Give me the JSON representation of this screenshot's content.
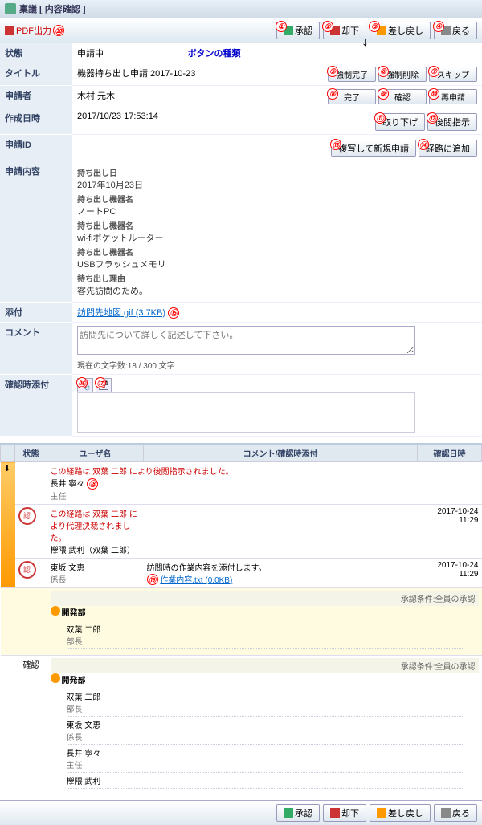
{
  "header": {
    "title": "稟議  [ 内容確認 ]"
  },
  "toolbar": {
    "pdf": "PDF出力",
    "buttons": {
      "approve": "承認",
      "reject": "却下",
      "sendback": "差し戻し",
      "back": "戻る"
    }
  },
  "button_types_label": "ボタンの種類",
  "action_grid": {
    "force_complete": "強制完了",
    "force_delete": "強制削除",
    "skip": "スキップ",
    "complete": "完了",
    "confirm": "確認",
    "reapply": "再申請",
    "withdraw": "取り下げ",
    "defer": "後閲指示",
    "copy_new": "複写して新規申請",
    "add_route": "経路に追加"
  },
  "details": {
    "status_label": "状態",
    "status_value": "申請中",
    "title_label": "タイトル",
    "title_value": "機器持ち出し申請 2017-10-23",
    "applicant_label": "申請者",
    "applicant_value": "木村 元木",
    "created_label": "作成日時",
    "created_value": "2017/10/23 17:53:14",
    "appid_label": "申請ID",
    "appid_value": "",
    "content_label": "申請内容",
    "carryout_date_label": "持ち出し日",
    "carryout_date_value": "2017年10月23日",
    "device_label": "持ち出し機器名",
    "device1": "ノートPC",
    "device2": "wi-fiポケットルーター",
    "device3": "USBフラッシュメモリ",
    "reason_label": "持ち出し理由",
    "reason_value": "客先訪問のため。",
    "attach_label": "添付",
    "attach_file": "訪問先地図.gif (3.7KB)",
    "comment_label": "コメント",
    "comment_placeholder": "訪問先について詳しく記述して下さい。",
    "char_count": "現在の文字数:18 / 300 文字",
    "confirm_attach_label": "確認時添付"
  },
  "route_headers": {
    "status": "状態",
    "user": "ユーザ名",
    "comment": "コメント/確認時添付",
    "datetime": "確認日時"
  },
  "route": [
    {
      "notice": "この経路は 双葉 二郎 により後閲指示されました。",
      "name": "長井 寧々",
      "role": "主任"
    },
    {
      "notice": "この経路は 双葉 二郎 により代理決裁されました。",
      "name": "欅隈 武利（双葉 二郎）",
      "role": "",
      "datetime": "2017-10-24 11:29",
      "stamp": "認"
    },
    {
      "name": "東坂 文恵",
      "role": "係長",
      "comment": "訪問時の作業内容を添付します。",
      "file": "作業内容.txt (0.0KB)",
      "datetime": "2017-10-24 11:29",
      "stamp": "認"
    }
  ],
  "route_dept": {
    "cond": "承認条件:全員の承認",
    "dept": "開発部",
    "current": [
      {
        "name": "双葉 二郎",
        "role": "部長"
      }
    ],
    "confirm_label": "確認",
    "confirm_users": [
      {
        "name": "双葉 二郎",
        "role": "部長"
      },
      {
        "name": "東坂 文恵",
        "role": "係長"
      },
      {
        "name": "長井 寧々",
        "role": "主任"
      },
      {
        "name": "欅隈 武利",
        "role": ""
      }
    ]
  },
  "markers": {
    "1": "①",
    "2": "②",
    "3": "③",
    "4": "④",
    "5": "⑤",
    "6": "⑥",
    "7": "⑦",
    "8": "⑧",
    "9": "⑨",
    "10": "⑩",
    "11": "⑪",
    "12": "⑫",
    "13": "⑬",
    "14": "⑭",
    "15": "⑮",
    "16": "⑯",
    "17": "⑰",
    "18": "⑱",
    "19": "⑲",
    "20": "⑳"
  }
}
